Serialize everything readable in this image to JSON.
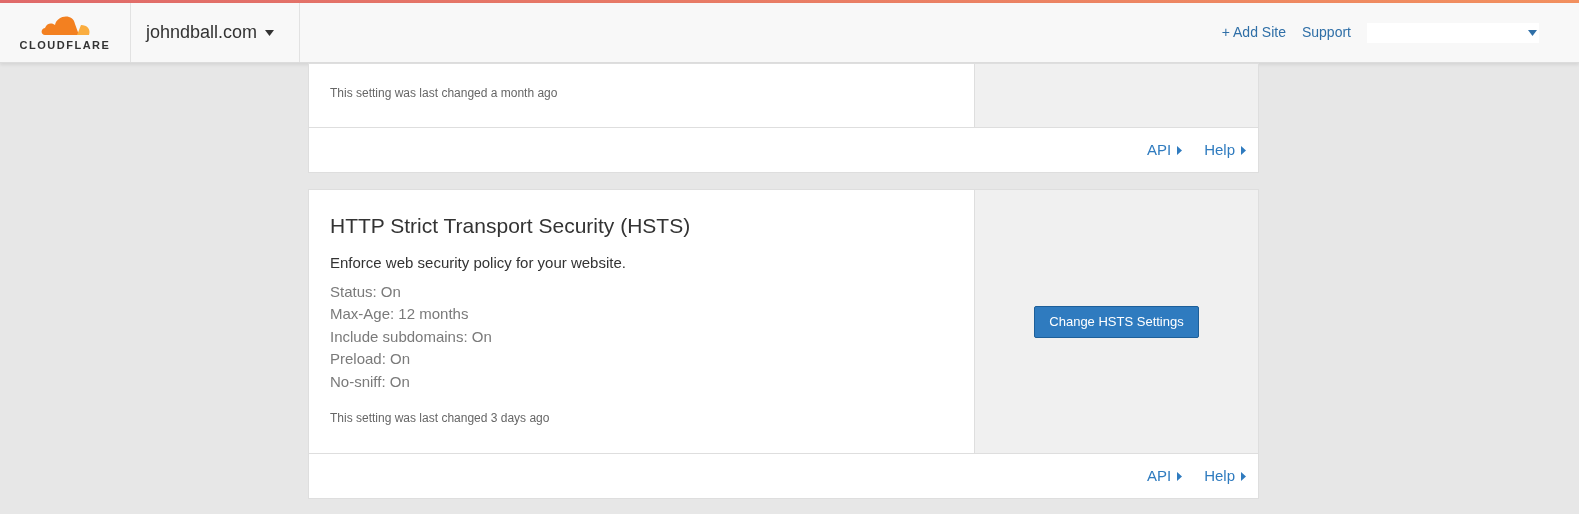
{
  "header": {
    "logo": "CLOUDFLARE",
    "site": "johndball.com",
    "links": [
      "+ Add Site",
      "Support"
    ]
  },
  "cards": [
    {
      "changed": "This setting was last changed a month ago",
      "footer_links": [
        "API",
        "Help"
      ]
    },
    {
      "title": "HTTP Strict Transport Security (HSTS)",
      "description": "Enforce web security policy for your website.",
      "details": [
        "Status: On",
        "Max-Age: 12 months",
        "Include subdomains: On",
        "Preload: On",
        "No-sniff: On"
      ],
      "changed": "This setting was last changed 3 days ago",
      "button": "Change HSTS Settings",
      "footer_links": [
        "API",
        "Help"
      ]
    }
  ]
}
